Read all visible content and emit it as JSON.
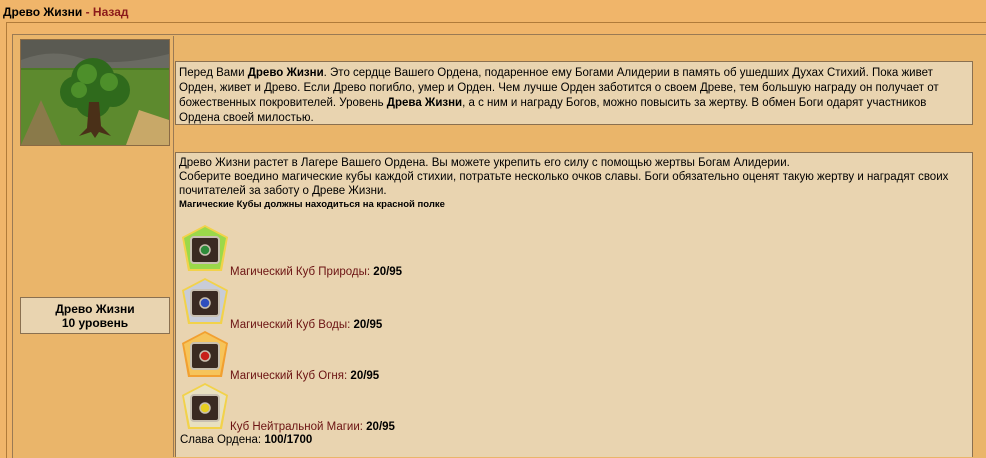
{
  "header": {
    "title": "Древо Жизни",
    "separator": " - ",
    "back_label": "Назад"
  },
  "description": {
    "part1": "Перед Вами ",
    "bold1": "Древо Жизни",
    "part2": ". Это сердце Вашего Ордена, подаренное ему Богами Алидерии в память об ушедших Духах Стихий. Пока живет Орден, живет и Древо. Если Древо погибло, умер и Орден. Чем лучше Орден заботится о своем Древе, тем большую награду он получает от божественных покровителей. Уровень ",
    "bold2": "Древа Жизни",
    "part3": ", а с ним и награду Богов, можно повысить за жертву. В обмен Боги одарят участников Ордена своей милостью."
  },
  "level": {
    "name": "Древо Жизни",
    "level_text": "10 уровень"
  },
  "main": {
    "line1": "Древо Жизни растет в Лагере Вашего Ордена. Вы можете укрепить его силу с помощью жертвы Богам Алидерии.",
    "line2": "Соберите воедино магические кубы каждой стихии, потратьте несколько очков славы. Боги обязательно оценят такую жертву и наградят своих почитателей за заботу о Древе Жизни.",
    "note": "Магические Кубы должны находиться на красной полке"
  },
  "cubes": [
    {
      "label": "Магический Куб Природы:",
      "value": "20/95",
      "gem_color": "#2e8b3a"
    },
    {
      "label": "Магический Куб Воды:",
      "value": "20/95",
      "gem_color": "#2f4fbf"
    },
    {
      "label": "Магический Куб Огня:",
      "value": "20/95",
      "gem_color": "#c8201a"
    },
    {
      "label": "Куб Нейтральной Магии:",
      "value": "20/95",
      "gem_color": "#e8d020"
    }
  ],
  "glory": {
    "label": "Слава Ордена:",
    "value": "100/1700"
  }
}
